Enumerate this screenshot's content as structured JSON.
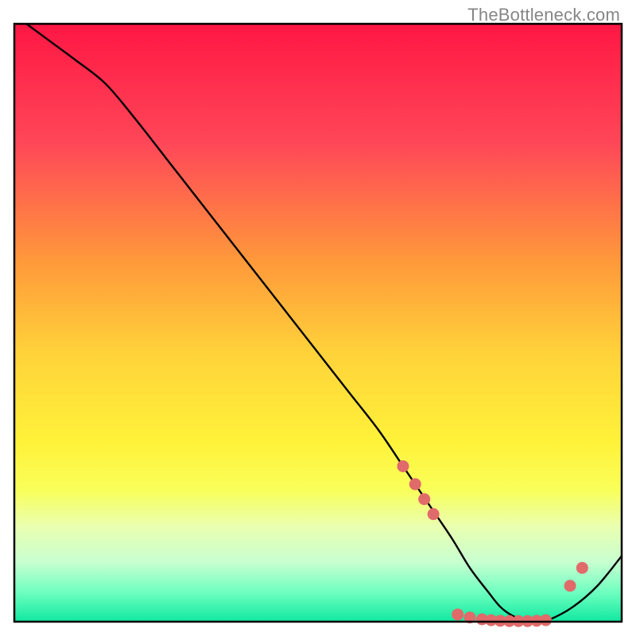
{
  "watermark": "TheBottleneck.com",
  "chart_data": {
    "type": "line",
    "title": "",
    "xlabel": "",
    "ylabel": "",
    "xlim": [
      0,
      100
    ],
    "ylim": [
      0,
      100
    ],
    "grid": false,
    "series": [
      {
        "name": "curve",
        "x": [
          2,
          6,
          10,
          15,
          20,
          25,
          30,
          35,
          40,
          45,
          50,
          55,
          60,
          64,
          68,
          72,
          75,
          78,
          80,
          82,
          84,
          86,
          88,
          92,
          96,
          100
        ],
        "y": [
          100,
          97,
          94,
          90,
          84,
          77.5,
          71,
          64.5,
          58,
          51.5,
          45,
          38.5,
          32,
          26,
          20,
          14,
          9,
          5,
          2.5,
          1,
          0.3,
          0,
          0.3,
          2.5,
          6,
          11
        ]
      }
    ],
    "markers": {
      "name": "dots",
      "color": "#e16a6a",
      "points": [
        {
          "x": 64,
          "y": 26
        },
        {
          "x": 66,
          "y": 23
        },
        {
          "x": 67.5,
          "y": 20.5
        },
        {
          "x": 69,
          "y": 18
        },
        {
          "x": 73,
          "y": 1.2
        },
        {
          "x": 75,
          "y": 0.7
        },
        {
          "x": 77,
          "y": 0.4
        },
        {
          "x": 78.5,
          "y": 0.25
        },
        {
          "x": 80,
          "y": 0.15
        },
        {
          "x": 81.5,
          "y": 0.1
        },
        {
          "x": 83,
          "y": 0.1
        },
        {
          "x": 84.5,
          "y": 0.1
        },
        {
          "x": 86,
          "y": 0.15
        },
        {
          "x": 87.5,
          "y": 0.25
        },
        {
          "x": 91.5,
          "y": 6
        },
        {
          "x": 93.5,
          "y": 9
        }
      ]
    },
    "gradient_stops": [
      {
        "offset": 0.0,
        "color": "#ff1744"
      },
      {
        "offset": 0.2,
        "color": "#ff4758"
      },
      {
        "offset": 0.4,
        "color": "#ff9a3a"
      },
      {
        "offset": 0.55,
        "color": "#ffd23a"
      },
      {
        "offset": 0.7,
        "color": "#fff23a"
      },
      {
        "offset": 0.78,
        "color": "#f9ff5a"
      },
      {
        "offset": 0.84,
        "color": "#eaffb0"
      },
      {
        "offset": 0.9,
        "color": "#c8ffd0"
      },
      {
        "offset": 0.95,
        "color": "#70ffc0"
      },
      {
        "offset": 1.0,
        "color": "#10e8a0"
      }
    ]
  }
}
